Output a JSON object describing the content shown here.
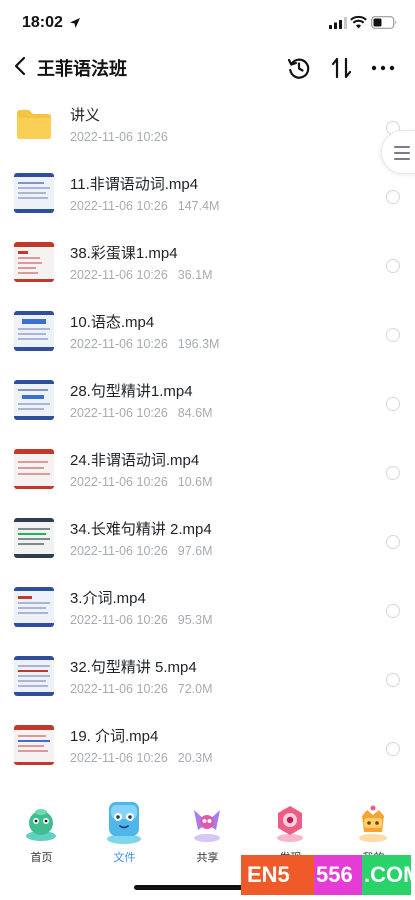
{
  "status_bar": {
    "time": "18:02"
  },
  "nav": {
    "title": "王菲语法班"
  },
  "files": [
    {
      "name": "讲义",
      "date": "2022-11-06 10:26",
      "size": "",
      "kind": "folder"
    },
    {
      "name": "11.非谓语动词.mp4",
      "date": "2022-11-06 10:26",
      "size": "147.4M",
      "kind": "video"
    },
    {
      "name": "38.彩蛋课1.mp4",
      "date": "2022-11-06 10:26",
      "size": "36.1M",
      "kind": "video"
    },
    {
      "name": "10.语态.mp4",
      "date": "2022-11-06 10:26",
      "size": "196.3M",
      "kind": "video"
    },
    {
      "name": "28.句型精讲1.mp4",
      "date": "2022-11-06 10:26",
      "size": "84.6M",
      "kind": "video"
    },
    {
      "name": "24.非谓语动词.mp4",
      "date": "2022-11-06 10:26",
      "size": "10.6M",
      "kind": "video"
    },
    {
      "name": "34.长难句精讲 2.mp4",
      "date": "2022-11-06 10:26",
      "size": "97.6M",
      "kind": "video"
    },
    {
      "name": "3.介词.mp4",
      "date": "2022-11-06 10:26",
      "size": "95.3M",
      "kind": "video"
    },
    {
      "name": "32.句型精讲 5.mp4",
      "date": "2022-11-06 10:26",
      "size": "72.0M",
      "kind": "video"
    },
    {
      "name": "19. 介词.mp4",
      "date": "2022-11-06 10:26",
      "size": "20.3M",
      "kind": "video"
    }
  ],
  "tabs": [
    {
      "label": "首页",
      "icon": "home-icon"
    },
    {
      "label": "文件",
      "icon": "files-icon",
      "active": true
    },
    {
      "label": "共享",
      "icon": "share-icon"
    },
    {
      "label": "发现",
      "icon": "discover-icon"
    },
    {
      "label": "我的",
      "icon": "profile-icon"
    }
  ],
  "watermark": {
    "part1": "EN5",
    "part2": "556",
    "part3": ".COM"
  },
  "colors": {
    "accent": "#3b8fea",
    "meta_text": "#a6abb3",
    "folder": "#f6c343"
  }
}
